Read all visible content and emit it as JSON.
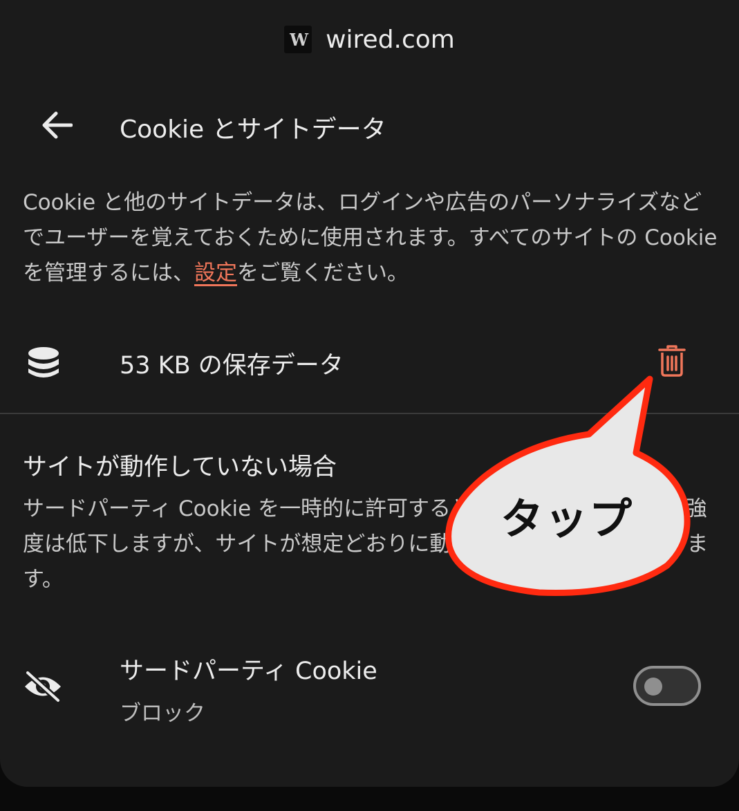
{
  "site": {
    "favicon_text": "W",
    "name": "wired.com"
  },
  "header": {
    "back_icon": "arrow-back-icon",
    "title": "Cookie とサイトデータ"
  },
  "description": {
    "before_link": "Cookie と他のサイトデータは、ログインや広告のパーソナライズなどでユーザーを覚えておくために使用されます。すべてのサイトの Cookie を管理するには、",
    "link": "設定",
    "after_link": "をご覧ください。"
  },
  "storage": {
    "icon": "database-icon",
    "label": "53 KB の保存データ",
    "delete_icon": "trash-icon",
    "delete_color": "#f0765a"
  },
  "section": {
    "title": "サイトが動作していない場合",
    "description": "サードパーティ Cookie を一時的に許可すると、ブラウジング保護の強度は低下しますが、サイトが想定どおりに動作する可能性が高くなります。"
  },
  "third_party": {
    "icon": "eye-off-icon",
    "title": "サードパーティ Cookie",
    "status": "ブロック",
    "toggle_on": false
  },
  "annotation": {
    "text": "タップ",
    "border_color": "#ff2a10",
    "fill_color": "#e8e8e8"
  }
}
